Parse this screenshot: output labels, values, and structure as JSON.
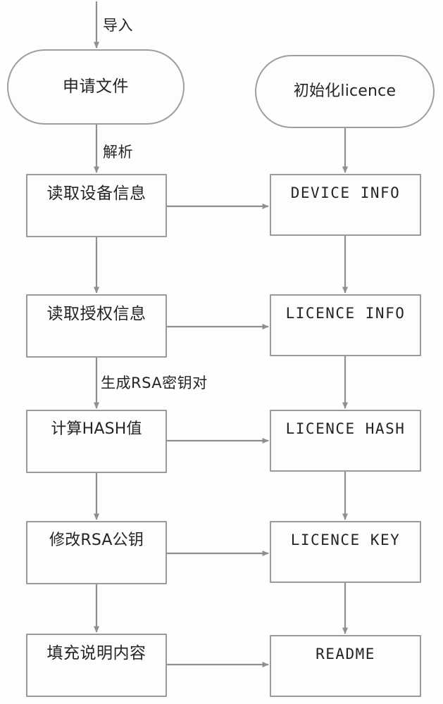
{
  "diagram": {
    "title": "licence generation flowchart",
    "stroke_color": "#9a9a9a",
    "text_color": "#242424",
    "background": "#fefefe"
  },
  "nodes": {
    "apply_file": {
      "label": "申请文件",
      "shape": "stadium"
    },
    "init_licence": {
      "label": "初始化licence",
      "shape": "stadium"
    },
    "read_device_info": {
      "label": "读取设备信息",
      "shape": "process"
    },
    "device_info": {
      "label": "DEVICE INFO",
      "shape": "process"
    },
    "read_auth_info": {
      "label": "读取授权信息",
      "shape": "process"
    },
    "licence_info": {
      "label": "LICENCE INFO",
      "shape": "process"
    },
    "calc_hash": {
      "label": "计算HASH值",
      "shape": "process"
    },
    "licence_hash": {
      "label": "LICENCE HASH",
      "shape": "process"
    },
    "modify_rsa_pubkey": {
      "label": "修改RSA公钥",
      "shape": "process"
    },
    "licence_key": {
      "label": "LICENCE KEY",
      "shape": "process"
    },
    "fill_readme": {
      "label": "填充说明内容",
      "shape": "process"
    },
    "readme": {
      "label": "README",
      "shape": "process"
    }
  },
  "edge_labels": {
    "import": "导入",
    "parse": "解析",
    "gen_rsa_keypair": "生成RSA密钥对"
  }
}
